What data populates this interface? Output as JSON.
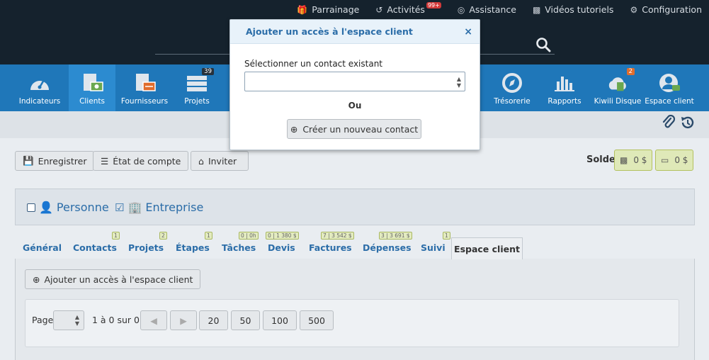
{
  "topbar": {
    "links": [
      {
        "label": "Parrainage",
        "icon": "gift-icon"
      },
      {
        "label": "Activités",
        "icon": "history-icon",
        "badge": "99+"
      },
      {
        "label": "Assistance",
        "icon": "lifebuoy-icon"
      },
      {
        "label": "Vidéos tutoriels",
        "icon": "film-icon"
      },
      {
        "label": "Configuration",
        "icon": "gear-icon"
      }
    ]
  },
  "nav": {
    "items": [
      {
        "label": "Indicateurs",
        "icon": "dashboard-icon"
      },
      {
        "label": "Clients",
        "icon": "clients-icon",
        "active": true
      },
      {
        "label": "Fournisseurs",
        "icon": "suppliers-icon"
      },
      {
        "label": "Projets",
        "icon": "projects-icon",
        "badge": "39"
      },
      {
        "label": "Trésorerie",
        "icon": "compass-icon"
      },
      {
        "label": "Rapports",
        "icon": "bar-chart-icon"
      },
      {
        "label": "Kiwili Disque",
        "icon": "cloud-disk-icon",
        "badge": "2"
      },
      {
        "label": "Espace client",
        "icon": "user-chat-icon"
      }
    ]
  },
  "toolbar": {
    "save": "Enregistrer",
    "account_statement": "État de compte",
    "invite": "Inviter",
    "balance_label": "Solde",
    "balance_cash": "0 $",
    "balance_card": "0 $"
  },
  "entity_type": {
    "person": "Personne",
    "company": "Entreprise"
  },
  "tabs": [
    {
      "label": "Général"
    },
    {
      "label": "Contacts",
      "badge": "1"
    },
    {
      "label": "Projets",
      "badge": "2"
    },
    {
      "label": "Étapes",
      "badge": "1"
    },
    {
      "label": "Tâches",
      "badge": "0 | 0h"
    },
    {
      "label": "Devis",
      "badge": "0 | 1 380 $"
    },
    {
      "label": "Factures",
      "badge": "7 | 3 542 $"
    },
    {
      "label": "Dépenses",
      "badge": "3 | 3 691 $"
    },
    {
      "label": "Suivi",
      "badge": "1"
    },
    {
      "label": "Espace client",
      "active": true
    }
  ],
  "content": {
    "add_access": "Ajouter un accès à l'espace client",
    "pager": {
      "page_label": "Page",
      "range": "1 à 0 sur 0",
      "sizes": [
        "20",
        "50",
        "100",
        "500"
      ]
    }
  },
  "modal": {
    "title": "Ajouter un accès à l'espace client",
    "close": "×",
    "select_label": "Sélectionner un contact existant",
    "select_value": "",
    "or": "Ou",
    "create_button": "Créer un nouveau contact"
  },
  "colors": {
    "topbar": "#15222d",
    "nav": "#1f77b9",
    "accent_text": "#2b6da8",
    "badge_red": "#d23b3b"
  }
}
